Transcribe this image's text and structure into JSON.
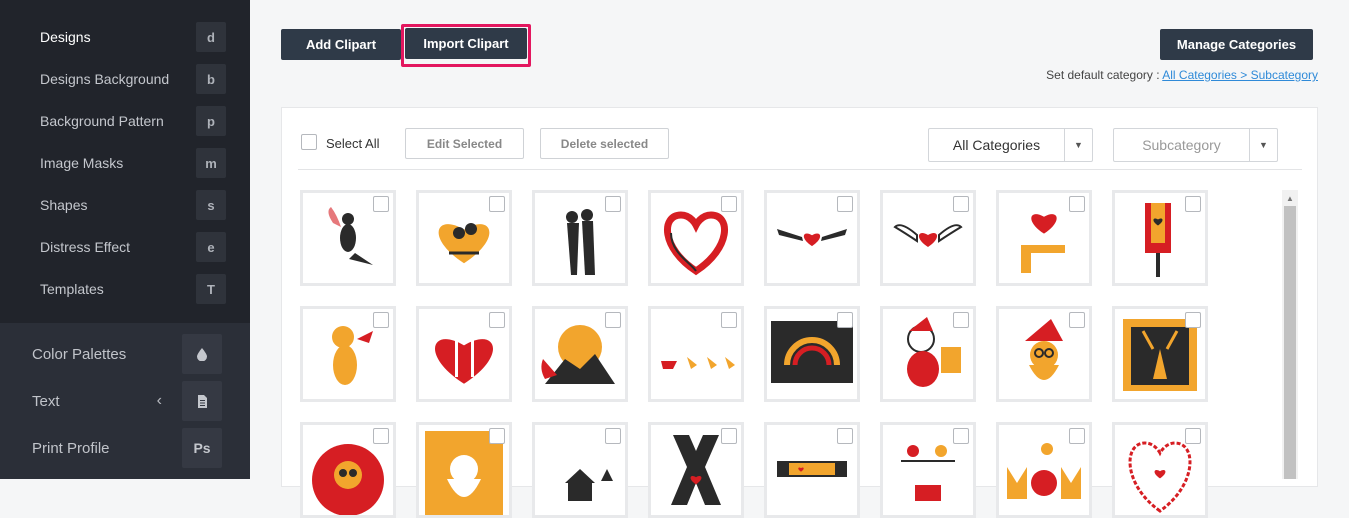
{
  "sidebar": {
    "sub_items": [
      {
        "label": "Designs",
        "key": "d"
      },
      {
        "label": "Designs Background",
        "key": "b"
      },
      {
        "label": "Background Pattern",
        "key": "p"
      },
      {
        "label": "Image Masks",
        "key": "m"
      },
      {
        "label": "Shapes",
        "key": "s"
      },
      {
        "label": "Distress Effect",
        "key": "e"
      },
      {
        "label": "Templates",
        "key": "T"
      }
    ],
    "main_items": [
      {
        "label": "Color Palettes",
        "icon": "droplet-icon",
        "glyph": "💧"
      },
      {
        "label": "Text",
        "icon": "document-icon",
        "glyph": "▤",
        "chevron": "‹"
      },
      {
        "label": "Print Profile",
        "icon": "photoshop-icon",
        "glyph": "Ps"
      }
    ]
  },
  "toolbar": {
    "add_label": "Add Clipart",
    "import_label": "Import Clipart",
    "manage_label": "Manage Categories",
    "default_prefix": "Set default category : ",
    "default_link": "All Categories > Subcategory"
  },
  "filters": {
    "select_all": "Select All",
    "edit_selected": "Edit Selected",
    "delete_selected": "Delete selected",
    "category": "All Categories",
    "subcategory": "Subcategory"
  },
  "clipart": [
    "fairy",
    "heart-couple",
    "kissing-couple",
    "red-heart-brush",
    "winged-heart",
    "winged-heart-ornate",
    "heart-hand",
    "paint-roller",
    "cupid",
    "heart-fork",
    "rooster-silhouette",
    "santa-sleigh",
    "nativity-rainbow",
    "santa-gifts",
    "santa-face",
    "reindeer-frame",
    "santa-round",
    "santa-beard",
    "winter-house",
    "x-letter",
    "love-you-mom",
    "birds-best",
    "mom-bird",
    "mom-heart"
  ],
  "colors": {
    "accent": "#e3175f",
    "red": "#d61e23",
    "orange": "#f2a52d",
    "dark": "#2f3a48",
    "link": "#2f8ad8"
  }
}
